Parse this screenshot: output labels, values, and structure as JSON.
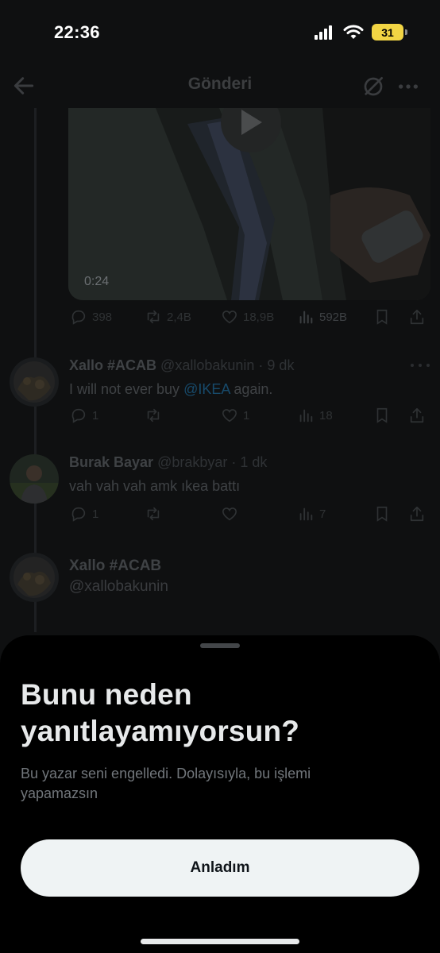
{
  "status_bar": {
    "time": "22:36",
    "battery_level": "31",
    "icons": [
      "cellular-signal-icon",
      "wifi-icon",
      "battery-icon"
    ]
  },
  "nav": {
    "title": "Gönderi",
    "icons": [
      "back-arrow-icon",
      "grok-icon",
      "more-icon"
    ]
  },
  "main_post": {
    "video_duration": "0:24",
    "actions": {
      "replies": "398",
      "reposts": "2,4B",
      "likes": "18,9B",
      "views": "592B"
    }
  },
  "replies": [
    {
      "name": "Xallo #ACAB",
      "handle": "@xallobakunin",
      "time": "· 9 dk",
      "text_before": "I will not ever buy ",
      "mention": "@IKEA",
      "text_after": " again.",
      "actions": {
        "replies": "1",
        "likes": "1",
        "views": "18"
      }
    },
    {
      "name": "Burak Bayar",
      "handle": "@brakbyar",
      "time": "· 1 dk",
      "text": "vah vah vah amk ıkea battı",
      "actions": {
        "replies": "1",
        "views": "7"
      }
    }
  ],
  "composer_author": {
    "name": "Xallo #ACAB",
    "handle": "@xallobakunin"
  },
  "sheet": {
    "title": "Bunu neden yanıtlayamıyorsun?",
    "body": "Bu yazar seni engelledi. Dolayısıyla, bu işlemi yapamazsın",
    "button_label": "Anladım"
  },
  "colors": {
    "sheet_background": "#000000",
    "button_background": "#eff3f4",
    "mention_blue": "#1d9bf0",
    "battery_yellow": "#f2d544"
  }
}
